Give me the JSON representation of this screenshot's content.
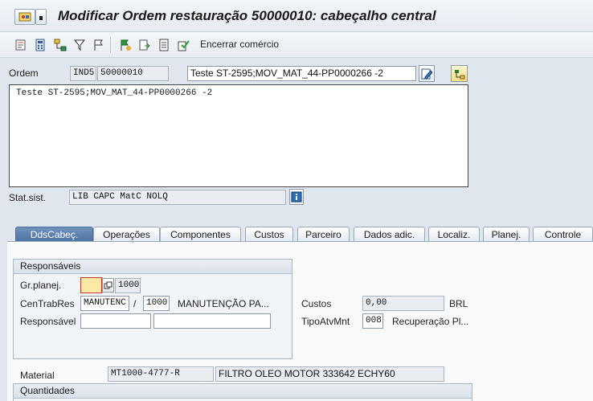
{
  "window": {
    "title": "Modificar Ordem restauração 50000010: cabeçalho central"
  },
  "toolbar": {
    "end_commerce_label": "Encerrar comércio"
  },
  "header": {
    "order_label": "Ordem",
    "order_type": "IND5",
    "order_number": "50000010",
    "order_description": "Teste ST-2595;MOV_MAT_44-PP0000266 -2",
    "long_text": "Teste ST-2595;MOV_MAT_44-PP0000266 -2",
    "status_label": "Stat.sist.",
    "status_value": "LIB  CAPC MatC NOLQ"
  },
  "tabs": [
    {
      "label": "DdsCabeç.",
      "active": true
    },
    {
      "label": "Operações",
      "active": false
    },
    {
      "label": "Componentes",
      "active": false
    },
    {
      "label": "Custos",
      "active": false
    },
    {
      "label": "Parceiro",
      "active": false
    },
    {
      "label": "Dados adic.",
      "active": false
    },
    {
      "label": "Localiz.",
      "active": false
    },
    {
      "label": "Planej.",
      "active": false
    },
    {
      "label": "Controle",
      "active": false
    }
  ],
  "responsaveis": {
    "title": "Responsáveis",
    "planner_group_label": "Gr.planej.",
    "planner_group_value": "",
    "planner_plant": "1000",
    "work_center_label": "CenTrabRes",
    "work_center_value": "MANUTENC",
    "separator": "/",
    "work_center_plant": "1000",
    "work_center_desc": "MANUTENÇÃO PA...",
    "responsible_label": "Responsável",
    "responsible_value": "",
    "responsible_desc": ""
  },
  "costs": {
    "label": "Custos",
    "value": "0,00",
    "currency": "BRL",
    "activity_type_label": "TipoAtvMnt",
    "activity_type_value": "008",
    "activity_type_desc": "Recuperação Pl..."
  },
  "material": {
    "label": "Material",
    "number": "MT1000-4777-R",
    "description": "FILTRO OLEO MOTOR 333642 ECHY60"
  },
  "quantities": {
    "title": "Quantidades"
  },
  "colors": {
    "active_tab": "#5a7eac",
    "background": "#dfe6ee",
    "required_field": "#fde9a6"
  }
}
